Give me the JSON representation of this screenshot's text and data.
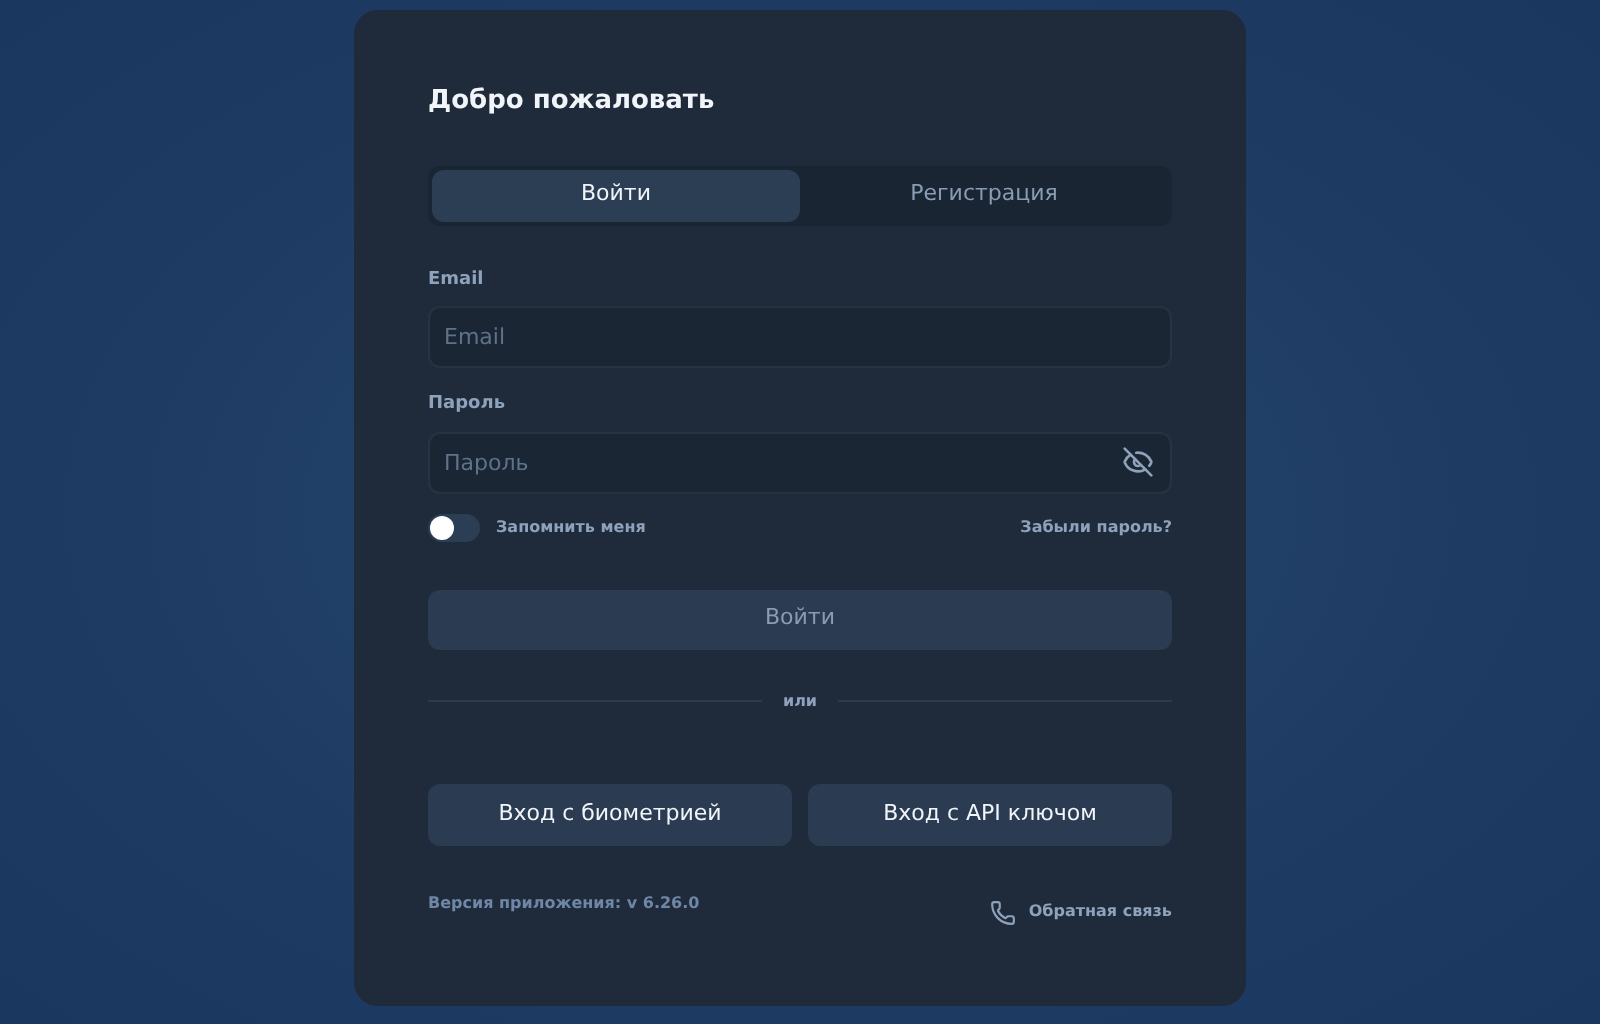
{
  "title": "Добро пожаловать",
  "tabs": [
    {
      "label": "Войти",
      "selected": true
    },
    {
      "label": "Регистрация",
      "selected": false
    }
  ],
  "fields": [
    {
      "label": "Email",
      "placeholder": "Email",
      "kind": "text"
    },
    {
      "label": "Пароль",
      "placeholder": "Пароль",
      "kind": "password"
    }
  ],
  "remember": {
    "label": "Запомнить меня",
    "on": false
  },
  "forgot_link": "Забыли пароль?",
  "submit": {
    "label": "Войти",
    "disabled": true
  },
  "divider": "или",
  "alt_buttons": [
    "Вход с биометрией",
    "Вход с API ключом"
  ],
  "version": "Версия приложения: v 6.26.0",
  "feedback_link": "Обратная связь"
}
